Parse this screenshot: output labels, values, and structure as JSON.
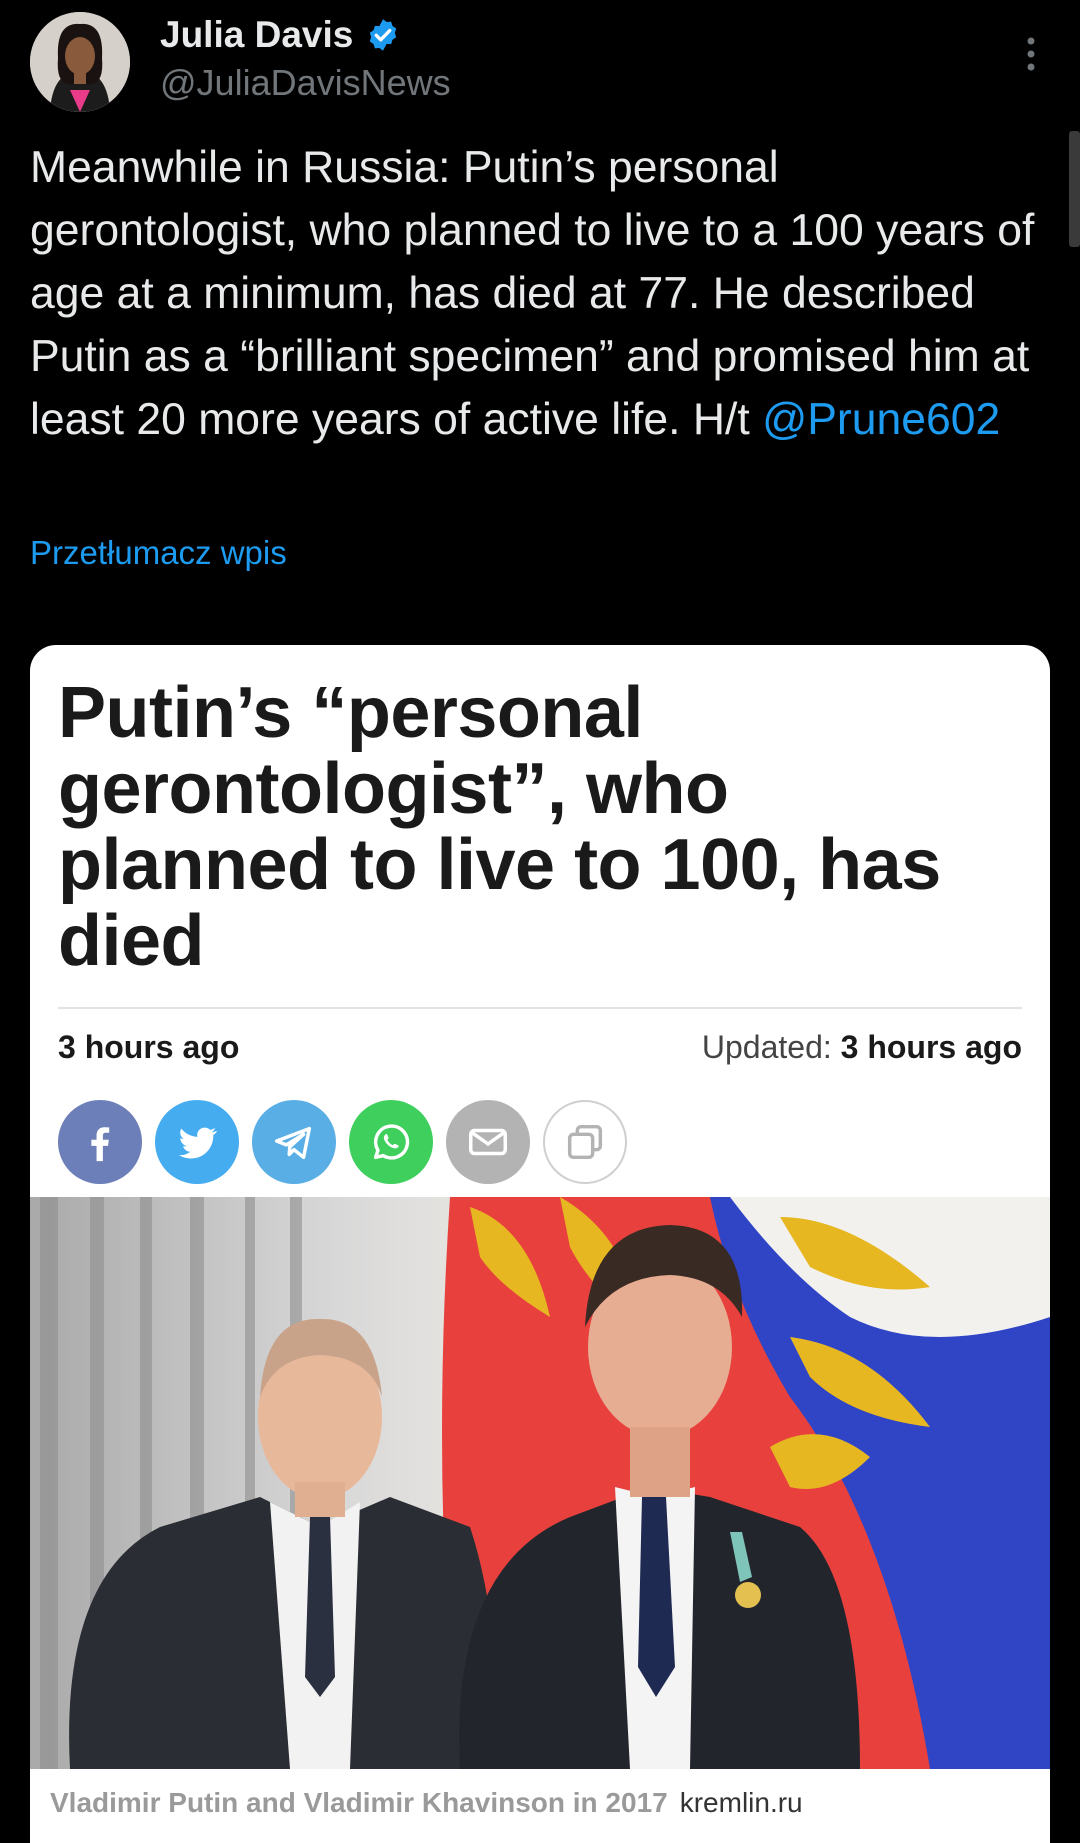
{
  "author": {
    "name": "Julia Davis",
    "handle": "@JuliaDavisNews"
  },
  "icons": {
    "verified": "verified-badge-icon",
    "more": "more-vertical-icon"
  },
  "tweet": {
    "text": "Meanwhile in Russia: Putin’s personal gerontologist, who planned to live to a 100 years of age at a minimum, has died at 77. He described Putin as a “brilliant specimen” and promised him at least 20 more years of active life. H/t ",
    "mention": "@Prune602",
    "translate_label": "Przetłumacz wpis"
  },
  "card": {
    "headline": "Putin’s “personal gerontologist”, who planned to live to 100, has died",
    "published": "3 hours ago",
    "updated_label": "Updated: ",
    "updated_value": "3 hours ago",
    "share_buttons": [
      "facebook-icon",
      "twitter-icon",
      "telegram-icon",
      "whatsapp-icon",
      "email-icon",
      "copy-icon"
    ],
    "photo_caption": "Vladimir Putin and Vladimir Khavinson in 2017",
    "photo_source": "kremlin.ru"
  },
  "colors": {
    "background": "#000000",
    "link": "#1d9bf0",
    "facebook": "#6d7fb8",
    "twitter": "#46acf0",
    "telegram": "#5aaee6",
    "whatsapp": "#3fcf5c",
    "email": "#b3b3b3"
  }
}
